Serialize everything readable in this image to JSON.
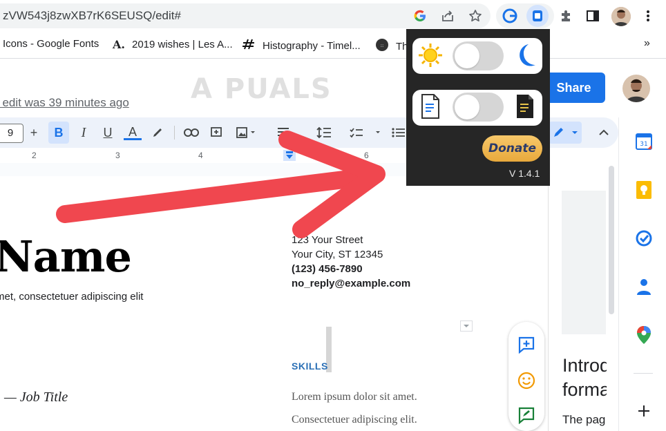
{
  "browser": {
    "url": "zVW543j8zwXB7rK6SEUSQ/edit#",
    "bookmarks": [
      {
        "label": "Icons - Google Fonts"
      },
      {
        "label": "2019 wishes | Les A..."
      },
      {
        "label": "Histography - Timel..."
      },
      {
        "label": "Th"
      }
    ],
    "bookmarks_more": "»"
  },
  "docs": {
    "last_edit": "t edit was 39 minutes ago",
    "share_label": "Share",
    "font_size": "9",
    "ruler_numbers": [
      "2",
      "3",
      "4",
      "6"
    ]
  },
  "watermark": "A  PUALS",
  "document": {
    "name": "Name",
    "subtitle": "met, consectetuer adipiscing elit",
    "job_title": "— Job Title",
    "address_line1": "123 Your Street",
    "address_line2": "Your City, ST 12345",
    "phone": "(123) 456-7890",
    "email": "no_reply@example.com",
    "skills_heading": "SKILLS",
    "lorem1": "Lorem ipsum dolor sit amet.",
    "lorem2": "Consectetuer adipiscing elit."
  },
  "side_panel": {
    "line1": "Introd",
    "line2": "forma",
    "line3": "The pag"
  },
  "extension_popup": {
    "donate_label": "Donate",
    "version": "V 1.4.1",
    "dark_mode_on": false,
    "doc_mode_on": false
  },
  "colors": {
    "accent": "#1a73e8",
    "popup_bg": "#262626",
    "arrow": "#f0474f",
    "skills": "#2a6fb5"
  }
}
